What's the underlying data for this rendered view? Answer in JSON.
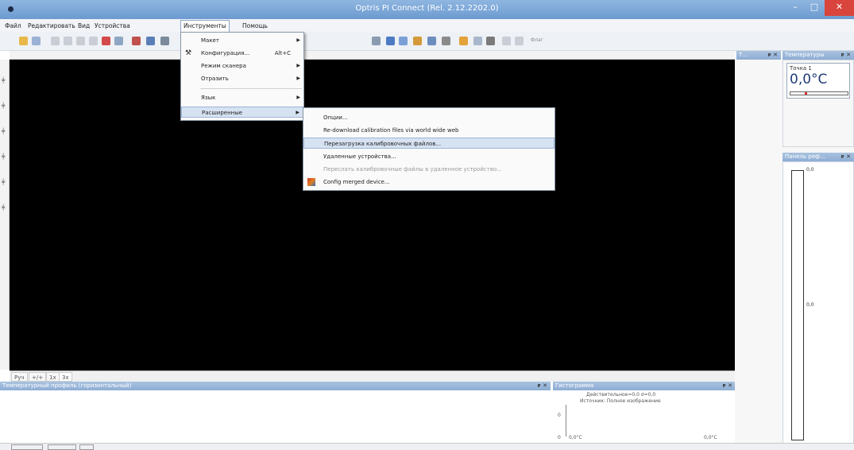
{
  "window": {
    "title": "Optris PI Connect (Rel. 2.12.2202.0)",
    "minimize": "–",
    "maximize": "□",
    "close": "✕"
  },
  "menubar": {
    "items": [
      "Файл",
      "Редактировать",
      "Вид",
      "Устройства",
      "Инструменты",
      "Помощь"
    ]
  },
  "toolbar": {
    "shutter_label": "Флаг"
  },
  "tools_menu": {
    "items": [
      {
        "label": "Макет",
        "shortcut": "",
        "submenu": true
      },
      {
        "label": "Конфигурация...",
        "shortcut": "Alt+C",
        "submenu": false
      },
      {
        "label": "Режим сканера",
        "shortcut": "",
        "submenu": true
      },
      {
        "label": "Отразить",
        "shortcut": "",
        "submenu": true
      },
      {
        "label": "Язык",
        "shortcut": "",
        "submenu": true
      },
      {
        "label": "Расширенные",
        "shortcut": "",
        "submenu": true
      }
    ]
  },
  "advanced_menu": {
    "items": [
      {
        "label": "Опции..."
      },
      {
        "label": "Re-download calibration files via world wide web"
      },
      {
        "label": "Перезагрузка калибровочных файлов..."
      },
      {
        "label": "Удаленные устройства..."
      },
      {
        "label": "Переслать калибровочные файлы в удаленное устройство..."
      },
      {
        "label": "Config merged device..."
      }
    ]
  },
  "view_tabs": [
    "Руч",
    "+/+",
    "1x",
    "3x"
  ],
  "panels": {
    "profile_title": "Температурный профиль (горизонтальный)",
    "histogram_title": "Гистограмма",
    "histogram_line1": "Действительное=0,0 σ=0,0",
    "histogram_line2": "Источник: Полное изображение",
    "hist_axis_left": "0,0°C",
    "hist_axis_right": "0,0°C",
    "hist_y": "0",
    "right_top_title": "Т...",
    "temperature_title": "Температуры",
    "palette_title": "Панель реф...",
    "pin": "ᴘ ✕"
  },
  "temperature": {
    "point_label": "Точка 1",
    "value": "0,0°C"
  },
  "palette": {
    "top": "0,0",
    "middle": "0,0"
  },
  "colors": {
    "accent": "#6c9ad0",
    "highlight": "#d6e2f2",
    "image_bg": "#000000"
  }
}
